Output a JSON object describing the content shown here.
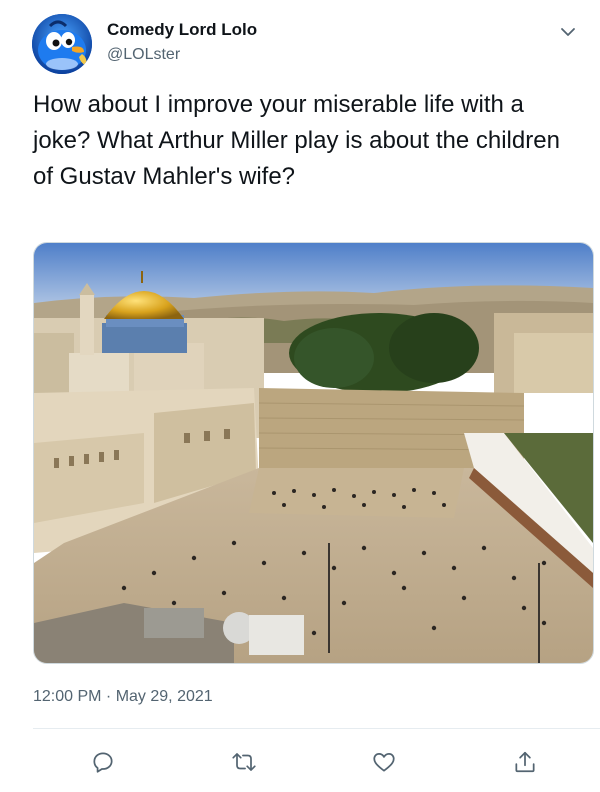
{
  "author": {
    "display_name": "Comedy Lord Lolo",
    "handle": "@LOLster",
    "avatar_icon": "cartoon-bird-avatar"
  },
  "tweet": {
    "text": "How about I improve your miserable life with a joke? What Arthur Miller play is about the children of Gustav Mahler's wife?",
    "timestamp": "12:00 PM · May 29, 2021",
    "media_icon": "photo-western-wall-jerusalem"
  },
  "actions": {
    "reply_icon": "reply-icon",
    "retweet_icon": "retweet-icon",
    "like_icon": "like-icon",
    "share_icon": "share-icon"
  },
  "colors": {
    "text_primary": "#0f1419",
    "text_secondary": "#536471",
    "icon_gray": "#536471",
    "divider": "#e6ecf0"
  }
}
